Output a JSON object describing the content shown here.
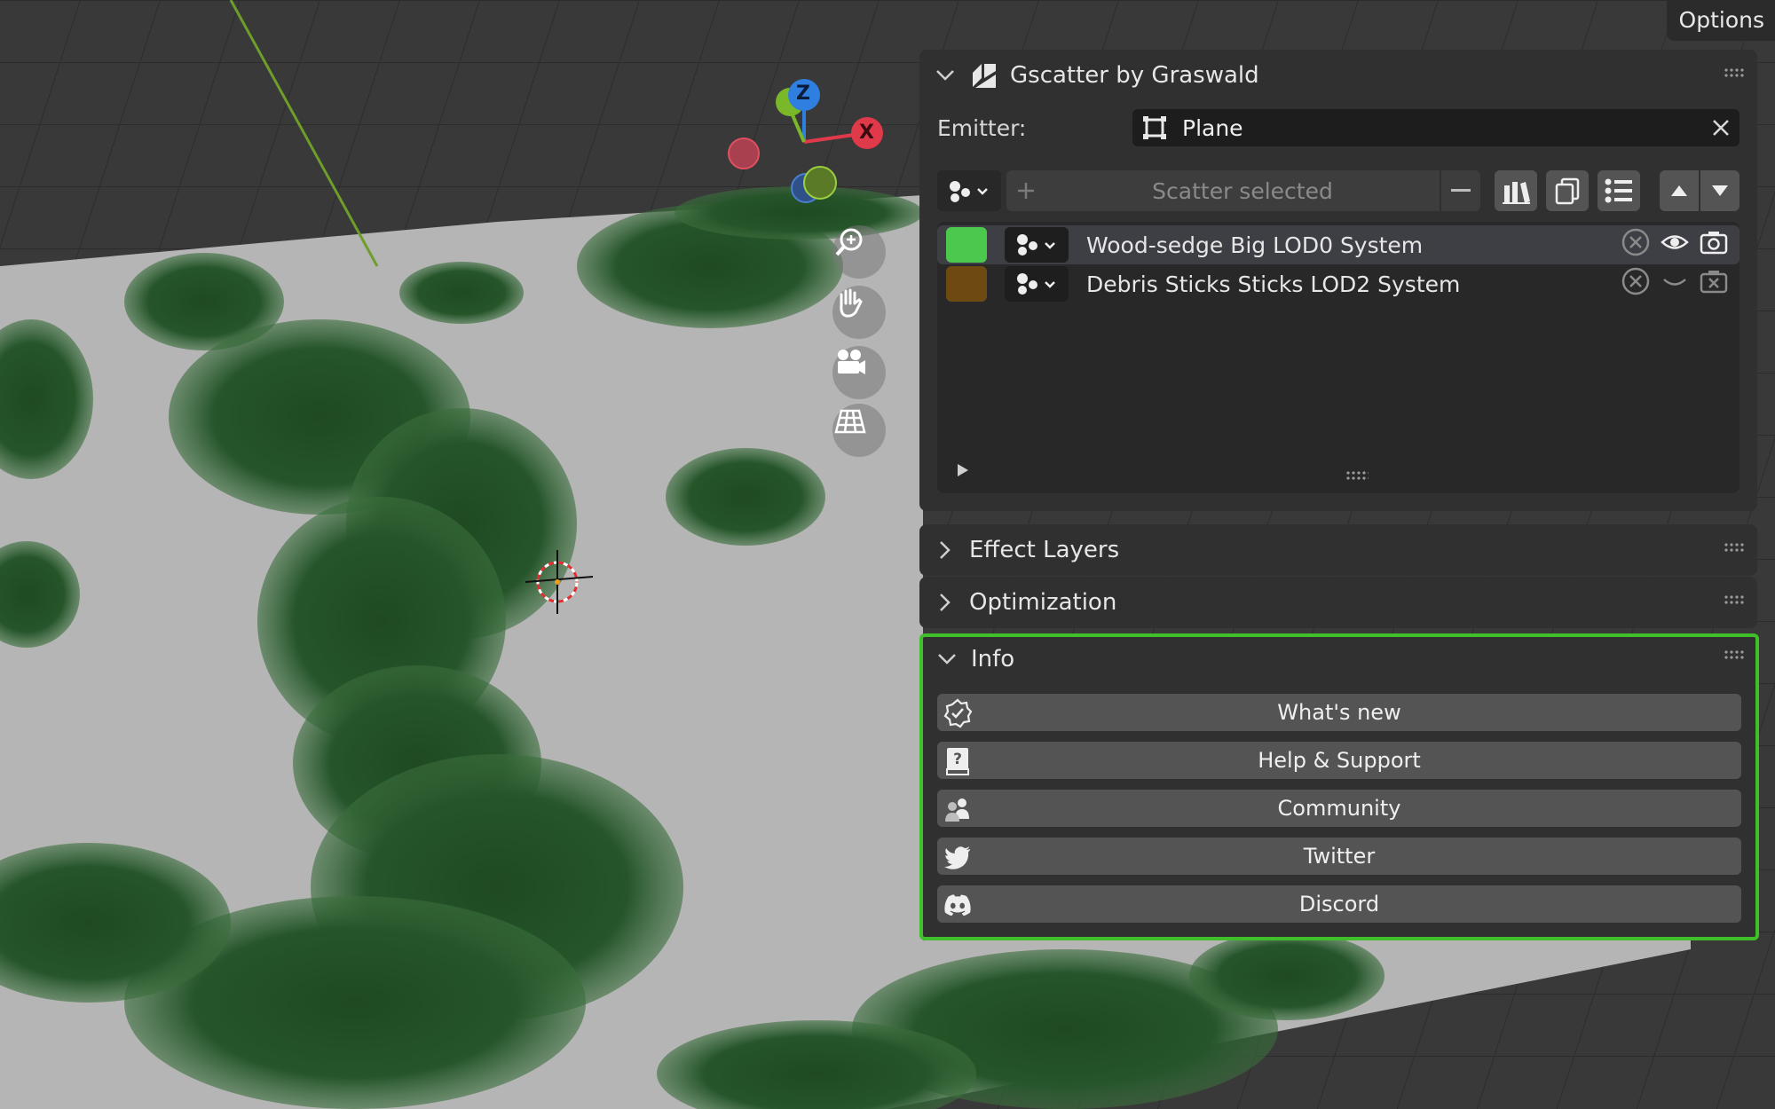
{
  "viewport": {
    "options_label": "Options",
    "gizmo": {
      "z": "Z",
      "x": "X"
    }
  },
  "gscatter": {
    "title": "Gscatter by Graswald",
    "emitter_label": "Emitter:",
    "emitter_value": "Plane",
    "scatter_button": "Scatter selected",
    "systems": [
      {
        "name": "Wood-sedge Big LOD0 System",
        "color": "#4cc94c",
        "active": true
      },
      {
        "name": "Debris Sticks Sticks LOD2 System",
        "color": "#6e4a12",
        "active": false
      }
    ]
  },
  "panels": {
    "effect_layers": "Effect Layers",
    "optimization": "Optimization",
    "info": "Info"
  },
  "info_buttons": [
    {
      "label": "What's new",
      "icon": "badge-check-icon"
    },
    {
      "label": "Help & Support",
      "icon": "help-book-icon"
    },
    {
      "label": "Community",
      "icon": "community-icon"
    },
    {
      "label": "Twitter",
      "icon": "twitter-icon"
    },
    {
      "label": "Discord",
      "icon": "discord-icon"
    }
  ],
  "colors": {
    "highlight": "#3fbf2a",
    "panel_bg": "#303030",
    "button_bg": "#545454"
  }
}
